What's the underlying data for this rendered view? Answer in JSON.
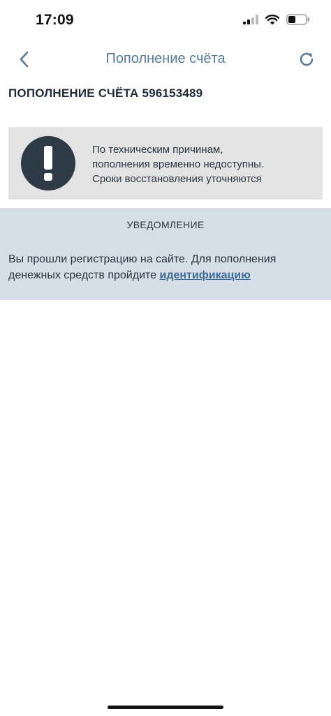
{
  "status_bar": {
    "time": "17:09",
    "icons": [
      "cellular-signal-icon",
      "wifi-icon",
      "battery-icon"
    ]
  },
  "nav": {
    "title": "Пополнение счёта",
    "back_icon": "chevron-left-icon",
    "refresh_icon": "refresh-icon",
    "accent_color": "#5a7a95"
  },
  "page": {
    "heading": "ПОПОЛНЕНИЕ СЧЁТА 596153489"
  },
  "warning": {
    "icon": "exclamation-icon",
    "lines": [
      "По техническим причинам,",
      "пополнения временно недоступны.",
      "Сроки восстановления уточняются"
    ],
    "background_color": "#e3e3e3",
    "icon_color": "#2e3a46"
  },
  "notice": {
    "title": "УВЕДОМЛЕНИЕ",
    "line1": "Вы прошли регистрацию на сайте. Для пополнения",
    "line2_prefix": "денежных средств пройдите ",
    "link_text": "идентификацию",
    "background_color": "#d6dfe8",
    "link_color": "#3d6a94"
  }
}
